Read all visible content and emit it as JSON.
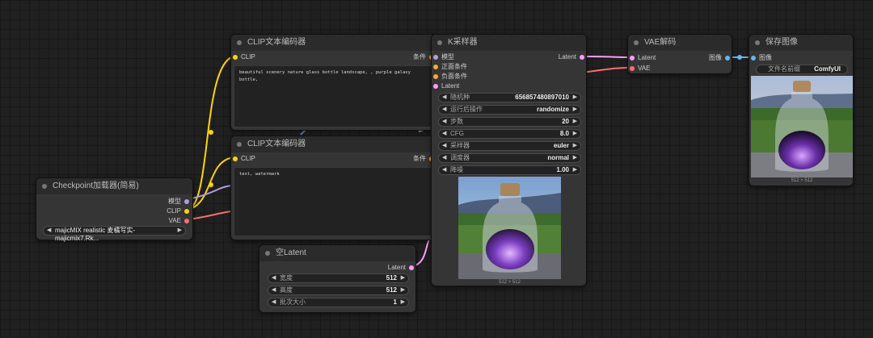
{
  "colors": {
    "clip": "#ffd500",
    "model": "#b39ddb",
    "vae": "#ff6e6e",
    "latent": "#ff9cf9",
    "image": "#64b5f6",
    "conditioning": "#ffa931"
  },
  "nodes": {
    "checkpoint": {
      "title": "Checkpoint加载器(简易)",
      "outputs": {
        "model": "模型",
        "clip": "CLIP",
        "vae": "VAE"
      },
      "ckpt_name": "majicMIX realistic 麦橘写实-majicmix7.Rk..."
    },
    "clip_pos": {
      "title": "CLIP文本编码器",
      "input_clip": "CLIP",
      "output": "条件",
      "text": "beautiful scenery nature glass bottle landscape, , purple galaxy bottle,"
    },
    "clip_neg": {
      "title": "CLIP文本编码器",
      "input_clip": "CLIP",
      "output": "条件",
      "text": "text, watermark"
    },
    "empty_latent": {
      "title": "空Latent",
      "output": "Latent",
      "width_label": "宽度",
      "width": "512",
      "height_label": "高度",
      "height": "512",
      "batch_label": "批次大小",
      "batch": "1"
    },
    "ksampler": {
      "title": "K采样器",
      "inputs": {
        "model": "模型",
        "positive": "正面条件",
        "negative": "负面条件",
        "latent": "Latent"
      },
      "output": "Latent",
      "widgets": [
        {
          "label": "随机种",
          "value": "656857480897010"
        },
        {
          "label": "运行后操作",
          "value": "randomize"
        },
        {
          "label": "步数",
          "value": "20"
        },
        {
          "label": "CFG",
          "value": "8.0"
        },
        {
          "label": "采样器",
          "value": "euler"
        },
        {
          "label": "调度器",
          "value": "normal"
        },
        {
          "label": "降噪",
          "value": "1.00"
        }
      ],
      "preview_caption": "512 × 512"
    },
    "vae_decode": {
      "title": "VAE解码",
      "inputs": {
        "latent": "Latent",
        "vae": "VAE"
      },
      "output": "图像"
    },
    "save_image": {
      "title": "保存图像",
      "input": "图像",
      "prefix_label": "文件名前缀",
      "prefix_value": "ComfyUI",
      "caption": "512 × 512"
    }
  }
}
